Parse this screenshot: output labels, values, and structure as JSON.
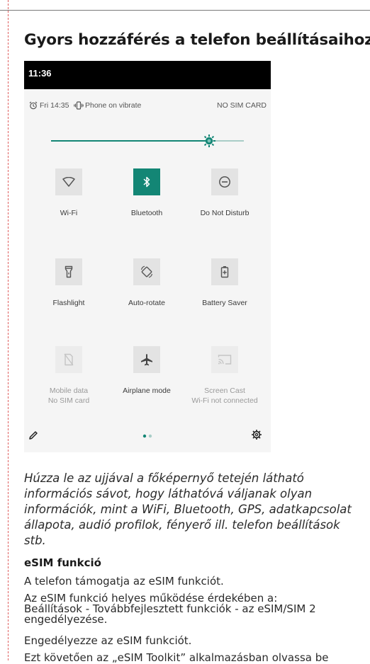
{
  "heading": "Gyors hozzáférés a telefon beállításaihoz",
  "phone": {
    "time": "11:36",
    "alarm_text": "Fri 14:35",
    "vibrate_text": "Phone on vibrate",
    "sim_status": "NO SIM CARD",
    "brightness_level": 0.82,
    "accent_color": "#138675",
    "tiles": [
      {
        "label": "Wi-Fi",
        "icon": "wifi-icon",
        "state": "off"
      },
      {
        "label": "Bluetooth",
        "icon": "bluetooth-icon",
        "state": "on"
      },
      {
        "label": "Do Not Disturb",
        "icon": "do-not-disturb-icon",
        "state": "off"
      },
      {
        "label": "Flashlight",
        "icon": "flashlight-icon",
        "state": "off"
      },
      {
        "label": "Auto-rotate",
        "icon": "auto-rotate-icon",
        "state": "off"
      },
      {
        "label": "Battery Saver",
        "icon": "battery-saver-icon",
        "state": "off"
      },
      {
        "label": "Mobile data",
        "sub": "No SIM card",
        "icon": "mobile-data-icon",
        "state": "disabled"
      },
      {
        "label": "Airplane mode",
        "icon": "airplane-icon",
        "state": "off"
      },
      {
        "label": "Screen Cast",
        "sub": "Wi-Fi not connected",
        "icon": "screen-cast-icon",
        "state": "disabled"
      }
    ]
  },
  "paragraph_lines": [
    "Húzza le az ujjával a főképernyő tetején látható",
    "információs sávot, hogy láthatóvá váljanak olyan",
    "információk, mint a WiFi, Bluetooth, GPS, adatkapcsolat",
    "állapota, audió profilok, fényerő ill. telefon beállítások",
    "stb."
  ],
  "esim": {
    "title": "eSIM funkció",
    "line1": "A telefon támogatja az eSIM funkciót.",
    "line2a": "Az eSIM funkció helyes működése érdekében a:",
    "line2b": "Beállítások - Továbbfejlesztett funkciók - az eSIM/SIM 2",
    "line2c": "engedélyezése.",
    "line3": "Engedélyezze az eSIM funkciót.",
    "line4": "Ezt követően az „eSIM Toolkit” alkalmazásban olvassa be"
  }
}
